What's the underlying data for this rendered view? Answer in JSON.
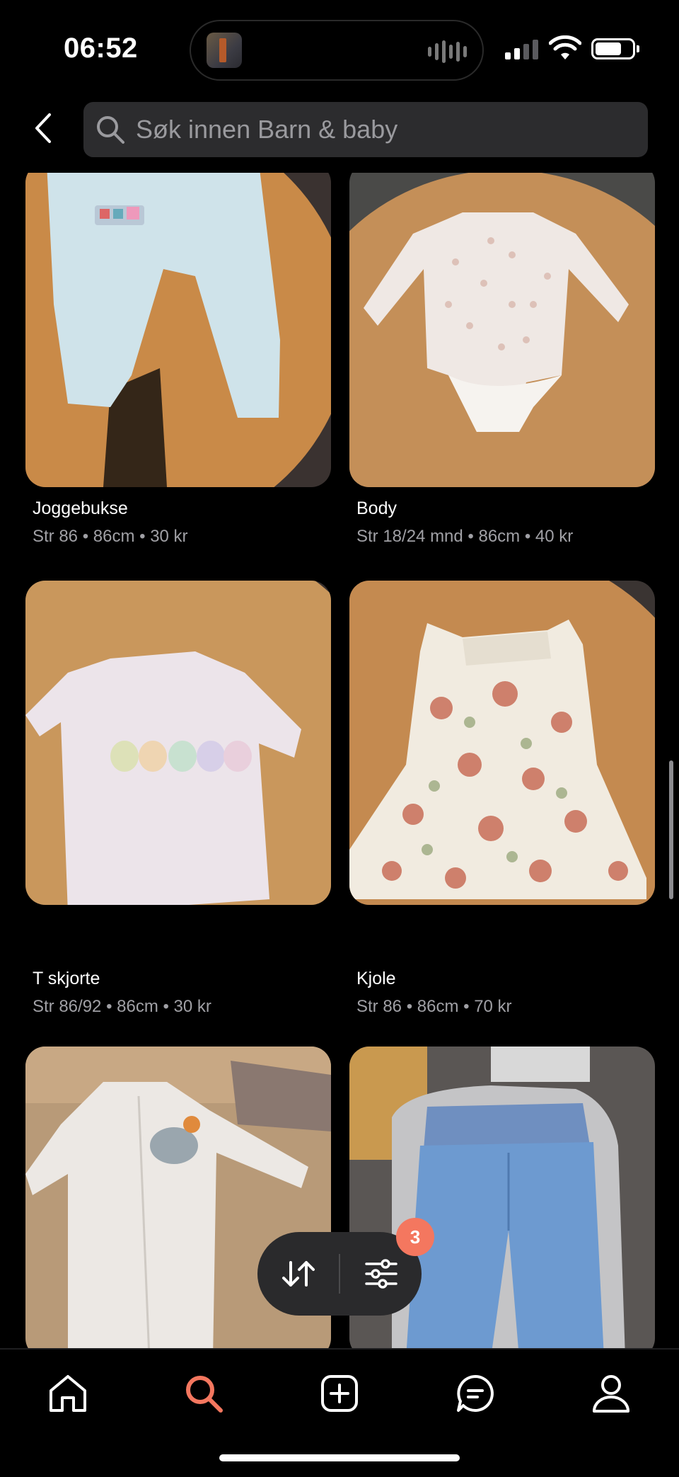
{
  "status_bar": {
    "time": "06:52"
  },
  "search": {
    "placeholder": "Søk innen Barn & baby"
  },
  "listings": [
    {
      "title": "Joggebukse",
      "meta": "Str 86 • 86cm • 30 kr"
    },
    {
      "title": "Body",
      "meta": "Str 18/24 mnd • 86cm • 40 kr"
    },
    {
      "title": "T skjorte",
      "meta": "Str 86/92 • 86cm • 30 kr"
    },
    {
      "title": "Kjole",
      "meta": "Str 86 • 86cm • 70 kr"
    },
    {
      "title": "",
      "meta": ""
    },
    {
      "title": "",
      "meta": ""
    }
  ],
  "filter": {
    "badge_count": "3"
  },
  "tabs": [
    {
      "icon": "home-icon",
      "active": false
    },
    {
      "icon": "search-icon",
      "active": true
    },
    {
      "icon": "add-icon",
      "active": false
    },
    {
      "icon": "messages-icon",
      "active": false
    },
    {
      "icon": "profile-icon",
      "active": false
    }
  ],
  "colors": {
    "accent": "#f4775f",
    "background": "#000000",
    "search_field": "#2c2c2e",
    "muted_text": "#a0a0a5"
  }
}
